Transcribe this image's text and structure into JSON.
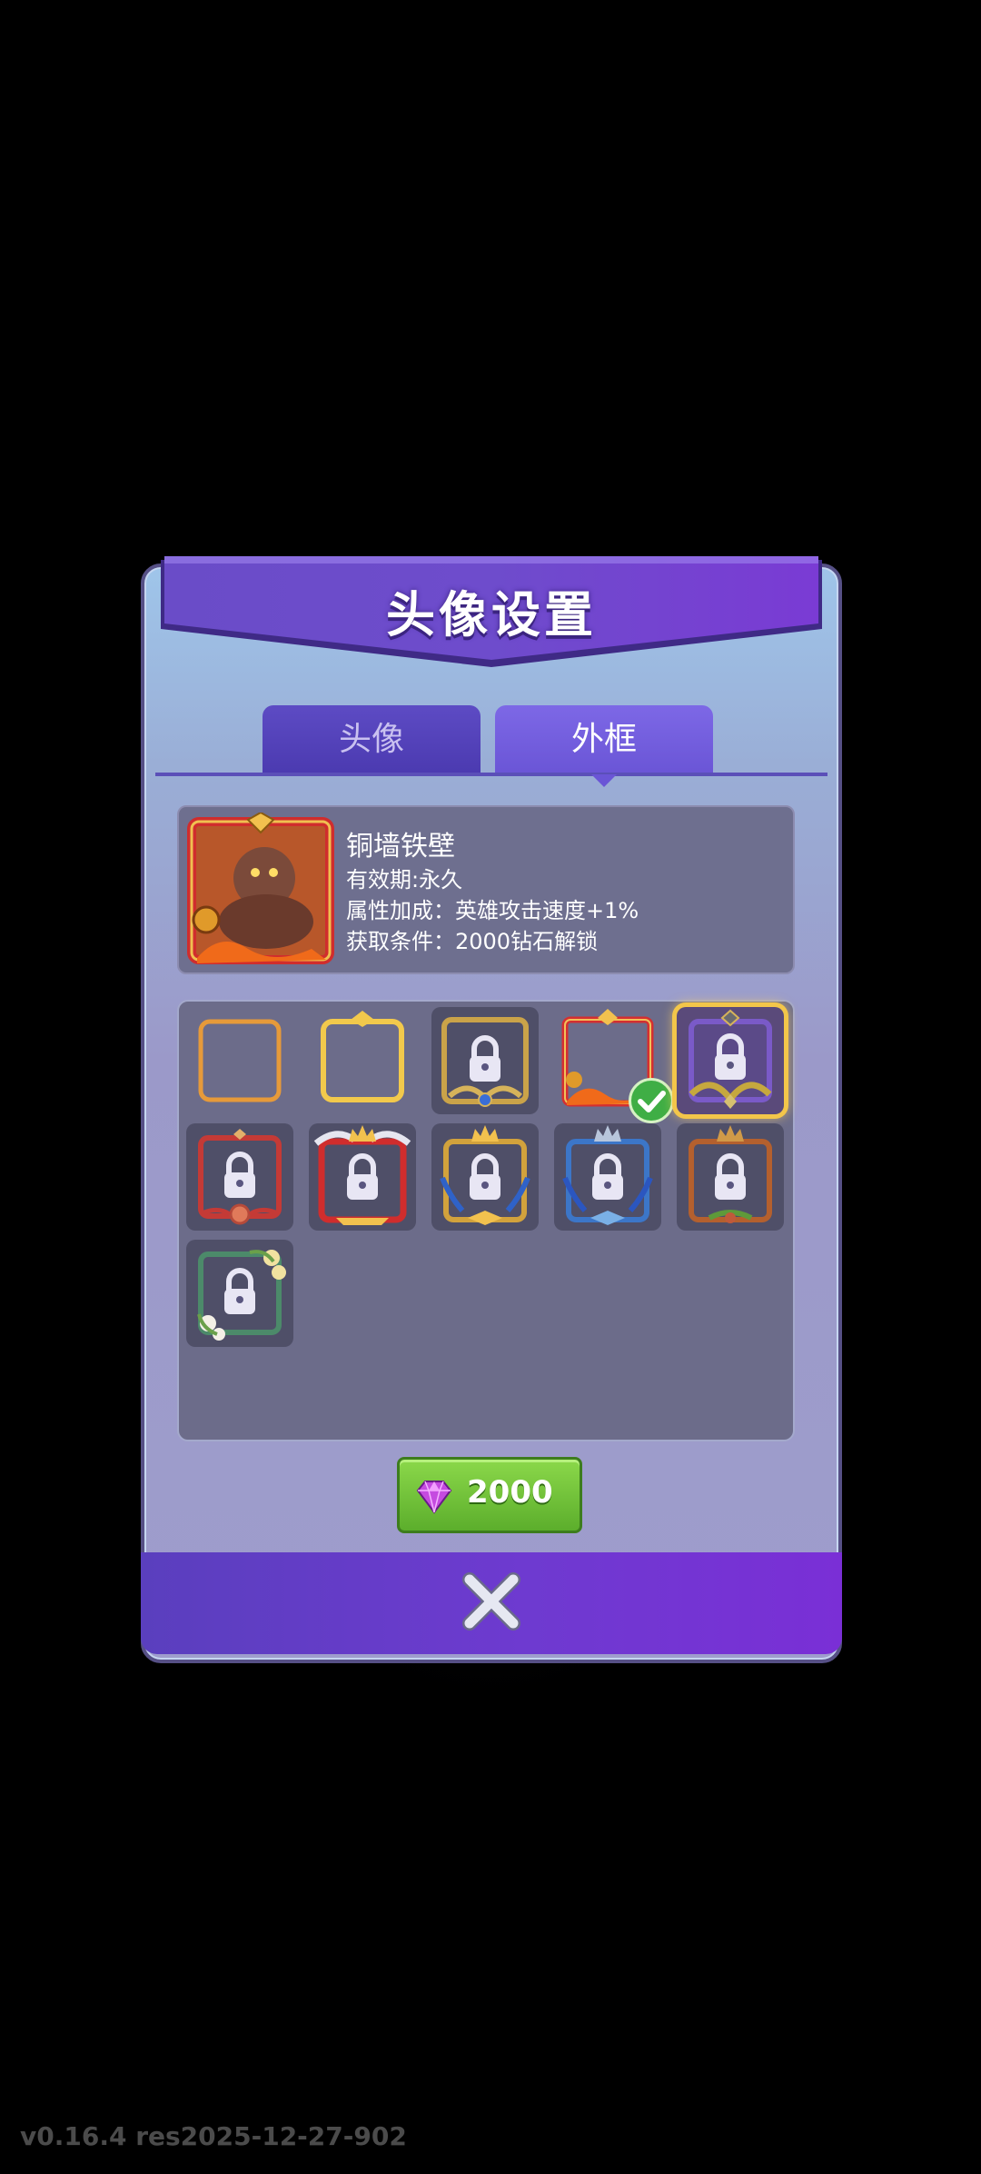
{
  "dialog": {
    "title": "头像设置",
    "tabs": [
      {
        "label": "头像",
        "active": false
      },
      {
        "label": "外框",
        "active": true
      }
    ]
  },
  "frame_info": {
    "name": "铜墙铁壁",
    "validity": "有效期:永久",
    "bonus": "属性加成：英雄攻击速度+1%",
    "condition": "获取条件：2000钻石解锁"
  },
  "frames": [
    {
      "id": 1,
      "state": "unlocked",
      "style": "orange-plain"
    },
    {
      "id": 2,
      "state": "unlocked",
      "style": "gold-plain"
    },
    {
      "id": 3,
      "state": "locked",
      "style": "gold-ornate"
    },
    {
      "id": 4,
      "state": "equipped",
      "style": "fire-red"
    },
    {
      "id": 5,
      "state": "locked-selected",
      "style": "purple-laurel"
    },
    {
      "id": 6,
      "state": "locked",
      "style": "red-rose"
    },
    {
      "id": 7,
      "state": "locked",
      "style": "red-winged-crown"
    },
    {
      "id": 8,
      "state": "locked",
      "style": "gold-crown-blue"
    },
    {
      "id": 9,
      "state": "locked",
      "style": "blue-silver-crown"
    },
    {
      "id": 10,
      "state": "locked",
      "style": "bronze-crown"
    },
    {
      "id": 11,
      "state": "locked",
      "style": "green-flower"
    }
  ],
  "buy_button": {
    "price": "2000",
    "icon": "gem-icon"
  },
  "close_icon": "close-icon",
  "version": "v0.16.4 res2025-12-27-902",
  "colors": {
    "accent_purple": "#6a55d6",
    "buy_green": "#6cc23a",
    "selected_gold": "#f3c64a"
  }
}
